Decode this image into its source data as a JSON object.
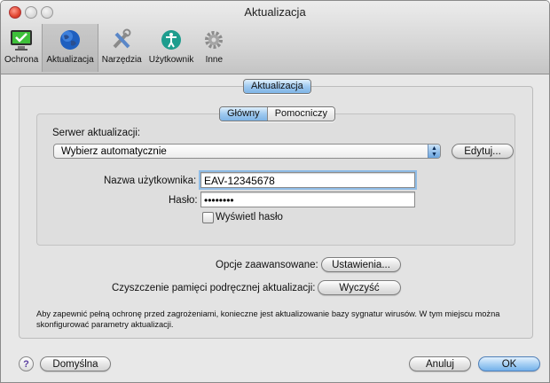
{
  "window": {
    "title": "Aktualizacja"
  },
  "toolbar": {
    "items": [
      {
        "label": "Ochrona",
        "icon": "monitor-checkmark-icon",
        "selected": false
      },
      {
        "label": "Aktualizacja",
        "icon": "globe-icon",
        "selected": true
      },
      {
        "label": "Narzędzia",
        "icon": "tools-icon",
        "selected": false
      },
      {
        "label": "Użytkownik",
        "icon": "accessibility-user-icon",
        "selected": false
      },
      {
        "label": "Inne",
        "icon": "gear-icon",
        "selected": false
      }
    ]
  },
  "main": {
    "section_tab": "Aktualizacja",
    "subtabs": [
      "Główny",
      "Pomocniczy"
    ],
    "server_label": "Serwer aktualizacji:",
    "server_value": "Wybierz automatycznie",
    "edit_button": "Edytuj...",
    "username_label": "Nazwa użytkownika:",
    "username_value": "EAV-12345678",
    "password_label": "Hasło:",
    "password_value": "••••••••",
    "show_password_label": "Wyświetl hasło",
    "advanced_label": "Opcje zaawansowane:",
    "settings_button": "Ustawienia...",
    "clear_cache_label": "Czyszczenie pamięci podręcznej aktualizacji:",
    "clear_button": "Wyczyść",
    "description": "Aby zapewnić pełną ochronę przed zagrożeniami, konieczne jest aktualizowanie bazy sygnatur wirusów. W tym miejscu można skonfigurować parametry aktualizacji."
  },
  "footer": {
    "help": "?",
    "default_button": "Domyślna",
    "cancel_button": "Anuluj",
    "ok_button": "OK"
  },
  "colors": {
    "accent": "#7fb4e6",
    "window_bg": "#e8e8e8"
  }
}
